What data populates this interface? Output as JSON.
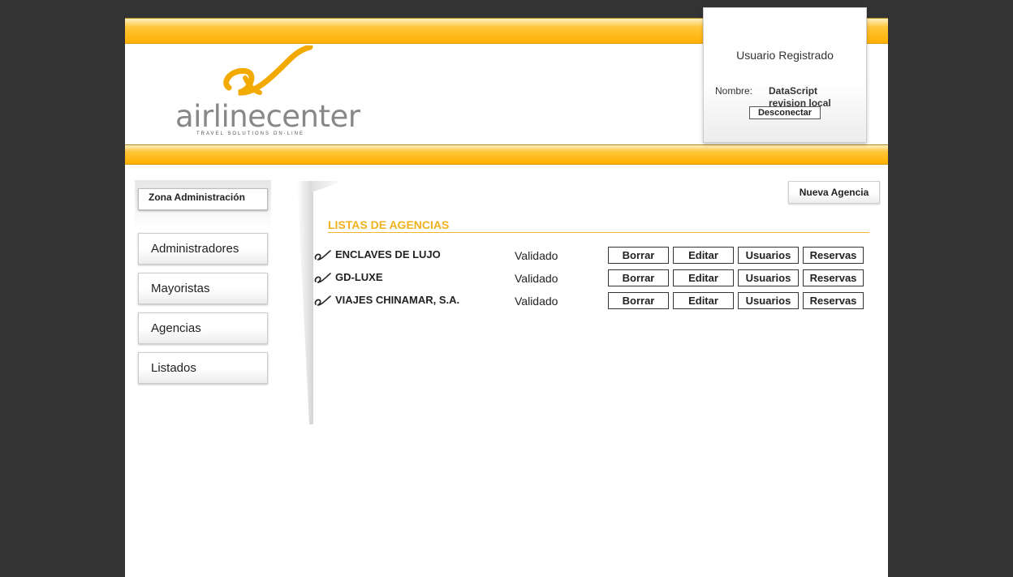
{
  "header": {
    "logo_word": "airlinecenter",
    "logo_tagline": "TRAVEL SOLUTIONS ON-LINE",
    "accent_color": "#ffb000"
  },
  "user_panel": {
    "title": "Usuario Registrado",
    "name_label": "Nombre:",
    "name_value": "DataScript revision local",
    "logout_label": "Desconectar"
  },
  "sidebar": {
    "zone_label": "Zona Administración",
    "items": [
      {
        "label": "Administradores"
      },
      {
        "label": "Mayoristas"
      },
      {
        "label": "Agencias"
      },
      {
        "label": "Listados"
      }
    ]
  },
  "main": {
    "new_button_label": "Nueva Agencia",
    "list_title": "LISTAS DE AGENCIAS",
    "title_color": "#f0b21c",
    "actions": {
      "delete": "Borrar",
      "edit": "Editar",
      "users": "Usuarios",
      "bookings": "Reservas"
    },
    "agencies": [
      {
        "name": "ENCLAVES DE LUJO",
        "status": "Validado"
      },
      {
        "name": "GD-LUXE",
        "status": "Validado"
      },
      {
        "name": "VIAJES CHINAMAR, S.A.",
        "status": "Validado"
      }
    ]
  }
}
